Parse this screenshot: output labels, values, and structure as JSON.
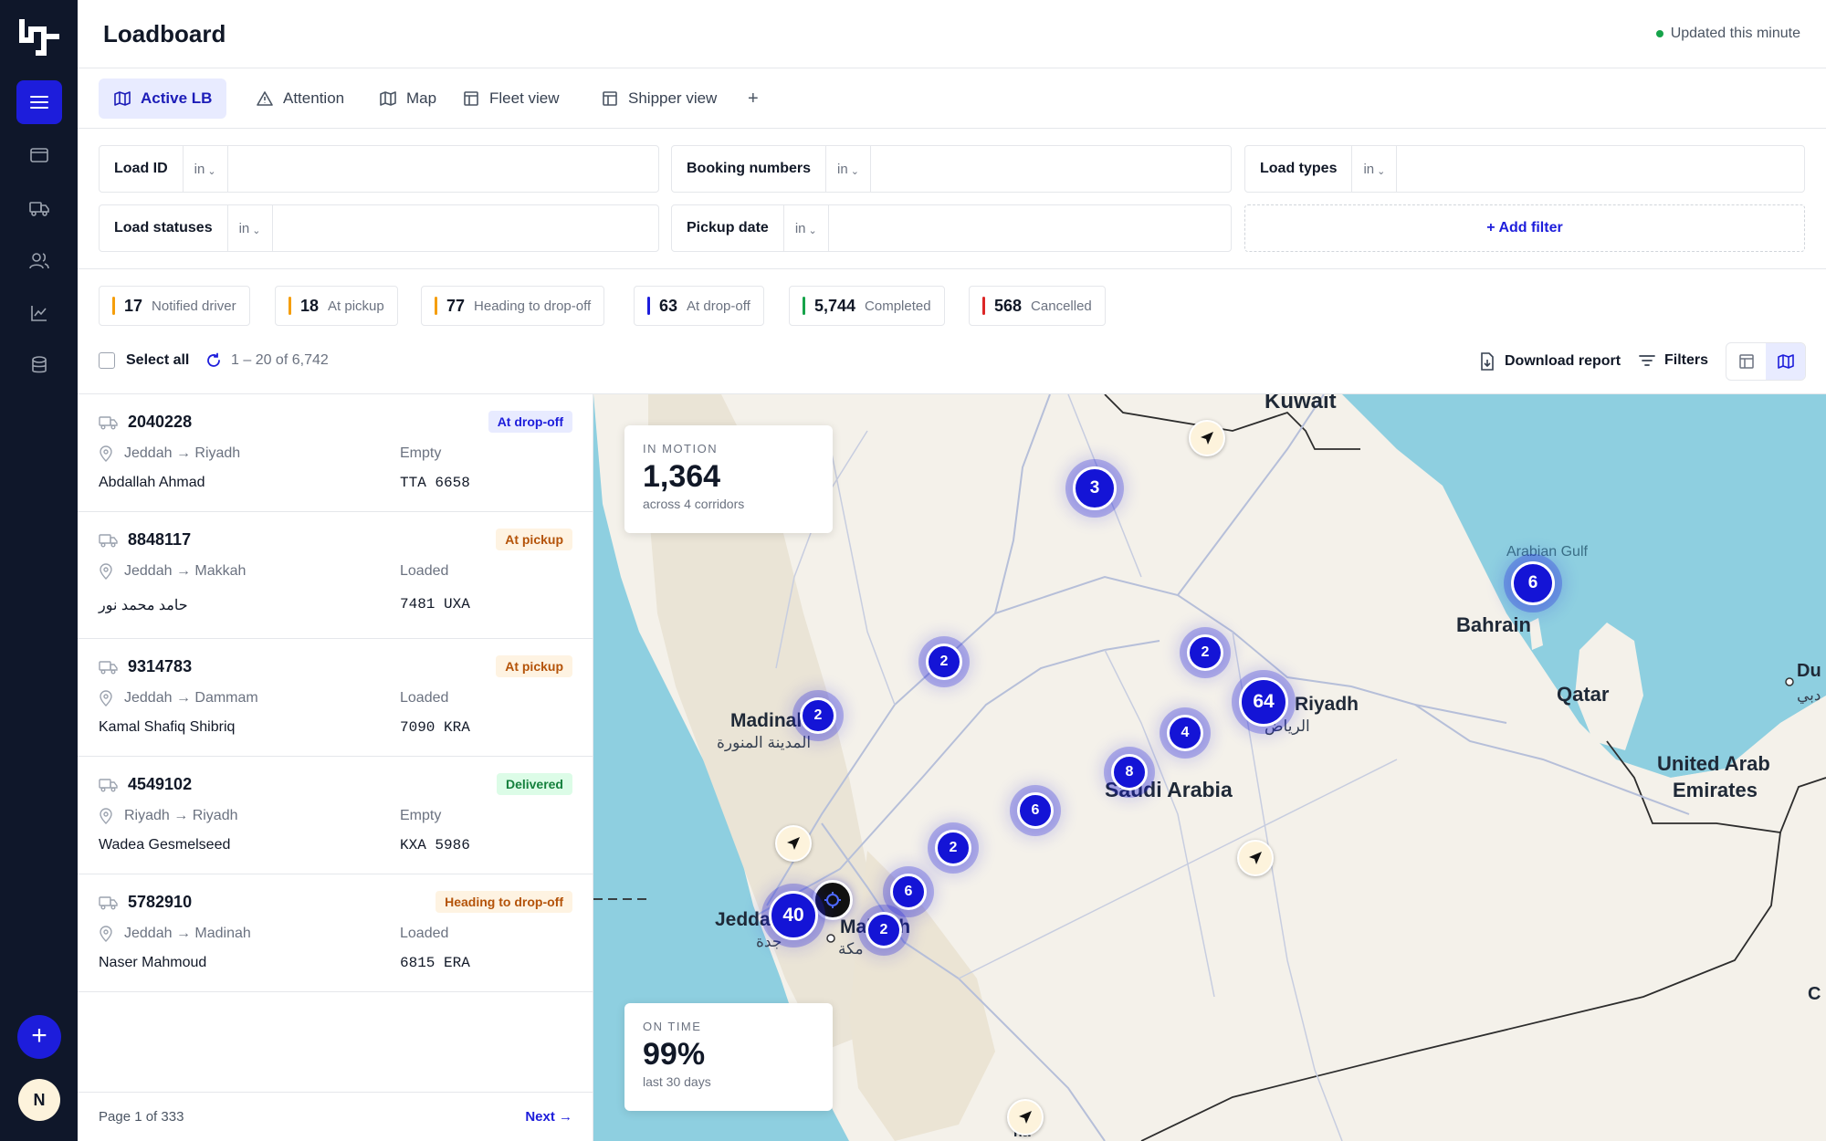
{
  "header": {
    "title": "Loadboard",
    "updated": "Updated this minute"
  },
  "tabs": [
    {
      "label": "Active LB",
      "icon": "map-icon",
      "active": true
    },
    {
      "label": "Attention",
      "icon": "warning-icon"
    },
    {
      "label": "Map",
      "icon": "map-icon"
    },
    {
      "label": "Fleet view",
      "icon": "table-icon"
    },
    {
      "label": "Shipper view",
      "icon": "table-icon"
    }
  ],
  "tab_add": "+",
  "filters": [
    {
      "label": "Load ID",
      "op": "in"
    },
    {
      "label": "Booking numbers",
      "op": "in"
    },
    {
      "label": "Load types",
      "op": "in"
    },
    {
      "label": "Load statuses",
      "op": "in"
    },
    {
      "label": "Pickup date",
      "op": "in"
    }
  ],
  "add_filter": "+ Add filter",
  "status_chips": [
    {
      "count": "17",
      "label": "Notified driver",
      "color": "#f59e0b"
    },
    {
      "count": "18",
      "label": "At pickup",
      "color": "#f59e0b"
    },
    {
      "count": "77",
      "label": "Heading to drop-off",
      "color": "#f59e0b"
    },
    {
      "count": "63",
      "label": "At drop-off",
      "color": "#1d1ddb"
    },
    {
      "count": "5,744",
      "label": "Completed",
      "color": "#16a34a"
    },
    {
      "count": "568",
      "label": "Cancelled",
      "color": "#dc2626"
    }
  ],
  "toolbar": {
    "select_all": "Select all",
    "range": "1 – 20 of 6,742",
    "download": "Download report",
    "filters": "Filters"
  },
  "loads": [
    {
      "id": "2040228",
      "status": "At drop-off",
      "route": "Jeddah → Riyadh",
      "load_state": "Empty",
      "driver": "Abdallah Ahmad",
      "plate": "TTA 6658"
    },
    {
      "id": "8848117",
      "status": "At pickup",
      "route": "Jeddah → Makkah",
      "load_state": "Loaded",
      "driver": "حامد محمد نور",
      "plate": "7481 UXA"
    },
    {
      "id": "9314783",
      "status": "At pickup",
      "route": "Jeddah → Dammam",
      "load_state": "Loaded",
      "driver": "Kamal Shafiq Shibriq",
      "plate": "7090 KRA"
    },
    {
      "id": "4549102",
      "status": "Delivered",
      "route": "Riyadh → Riyadh",
      "load_state": "Empty",
      "driver": "Wadea Gesmelseed",
      "plate": "KXA 5986"
    },
    {
      "id": "5782910",
      "status": "Heading to drop-off",
      "route": "Jeddah → Madinah",
      "load_state": "Loaded",
      "driver": "Naser Mahmoud",
      "plate": "6815 ERA"
    }
  ],
  "pager": {
    "info": "Page 1 of 333",
    "next": "Next →"
  },
  "map": {
    "in_motion": {
      "key": "IN MOTION",
      "value": "1,364",
      "sub": "across 4 corridors"
    },
    "on_time": {
      "key": "ON TIME",
      "value": "99%",
      "sub": "last 30 days"
    },
    "clusters": [
      "3",
      "2",
      "2",
      "2",
      "64",
      "4",
      "8",
      "6",
      "2",
      "6",
      "40",
      "2",
      "6"
    ],
    "labels": {
      "kuwait": "Kuwait",
      "arabian_gulf": "Arabian Gulf",
      "bahrain": "Bahrain",
      "qatar": "Qatar",
      "du": "Du",
      "du_ar": "دبي",
      "uae_1": "United Arab",
      "uae_2": "Emirates",
      "madinah": "Madinah",
      "madinah_ar": "المدينة المنورة",
      "riyadh": "Riyadh",
      "riyadh_ar": "الرياض",
      "saudi_arabia": "Saudi Arabia",
      "jeddah": "Jeddah",
      "jeddah_ar": "جدة",
      "makkah": "Makkah",
      "makkah_ar": "مكة",
      "c": "C",
      "bottom": "ha"
    }
  },
  "rail": {
    "fab": "+",
    "avatar": "N"
  },
  "colors": {
    "accent": "#1d1ddb",
    "rail": "#0f172a"
  }
}
